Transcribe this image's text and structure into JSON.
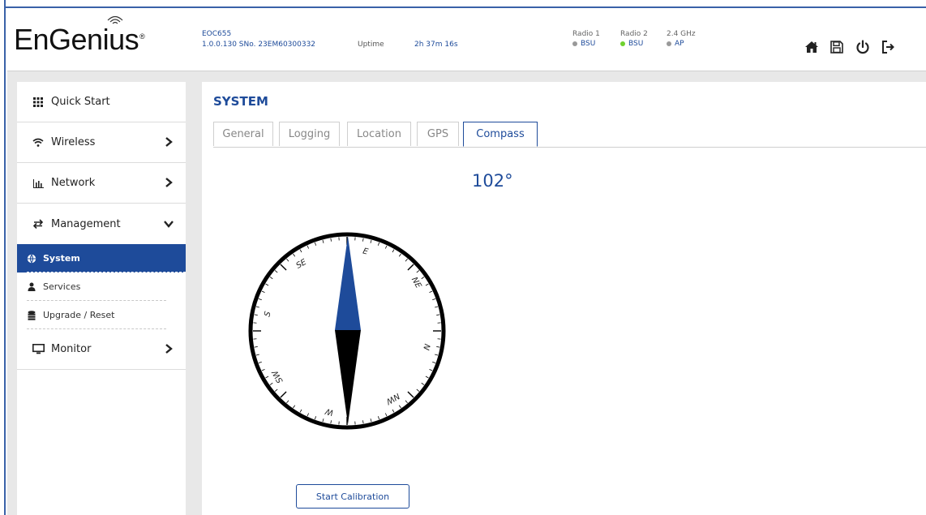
{
  "header": {
    "logo": "EnGenius",
    "device_model": "EOC655",
    "device_firmware_serial": "1.0.0.130 SNo. 23EM60300332",
    "uptime_label": "Uptime",
    "uptime_value": "2h 37m 16s",
    "radios": [
      {
        "label": "Radio 1",
        "status": "BSU",
        "dot_color": "#999999"
      },
      {
        "label": "Radio 2",
        "status": "BSU",
        "dot_color": "#6fd12f"
      },
      {
        "label": "2.4 GHz",
        "status": "AP",
        "dot_color": "#999999"
      }
    ],
    "icons": [
      "home-icon",
      "save-icon",
      "power-icon",
      "logout-icon"
    ]
  },
  "sidebar": {
    "items": [
      {
        "label": "Quick Start",
        "icon": "grid-icon"
      },
      {
        "label": "Wireless",
        "icon": "wifi-icon"
      },
      {
        "label": "Network",
        "icon": "bar-chart-icon"
      },
      {
        "label": "Management",
        "icon": "transfer-icon"
      },
      {
        "label": "Monitor",
        "icon": "monitor-icon"
      }
    ],
    "subitems": [
      {
        "label": "System",
        "icon": "globe-icon",
        "active": true
      },
      {
        "label": "Services",
        "icon": "user-icon",
        "active": false
      },
      {
        "label": "Upgrade / Reset",
        "icon": "database-icon",
        "active": false
      }
    ]
  },
  "content": {
    "title": "SYSTEM",
    "tabs": [
      {
        "label": "General",
        "active": false
      },
      {
        "label": "Logging",
        "active": false
      },
      {
        "label": "Location",
        "active": false
      },
      {
        "label": "GPS",
        "active": false
      },
      {
        "label": "Compass",
        "active": true
      }
    ],
    "heading_value": "102°",
    "compass_labels": [
      "E",
      "NE",
      "N",
      "NW",
      "W",
      "SW",
      "S",
      "SE"
    ],
    "calibration_button": "Start Calibration"
  },
  "colors": {
    "accent": "#1e4b9a",
    "band": "#e8e8e8",
    "active_dot": "#6fd12f"
  }
}
